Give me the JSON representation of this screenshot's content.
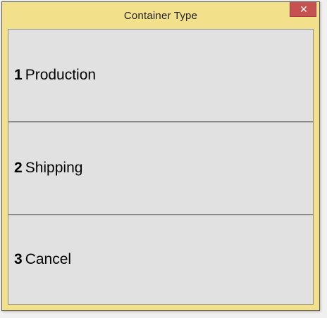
{
  "window": {
    "title": "Container Type",
    "close_glyph": "✕"
  },
  "options": [
    {
      "key": "1",
      "label": "Production"
    },
    {
      "key": "2",
      "label": "Shipping"
    },
    {
      "key": "3",
      "label": "Cancel"
    }
  ],
  "colors": {
    "titlebar": "#f2e08a",
    "close_button": "#c75050",
    "option_background": "#e1e1e1"
  },
  "icons": {
    "close": "close-icon"
  }
}
